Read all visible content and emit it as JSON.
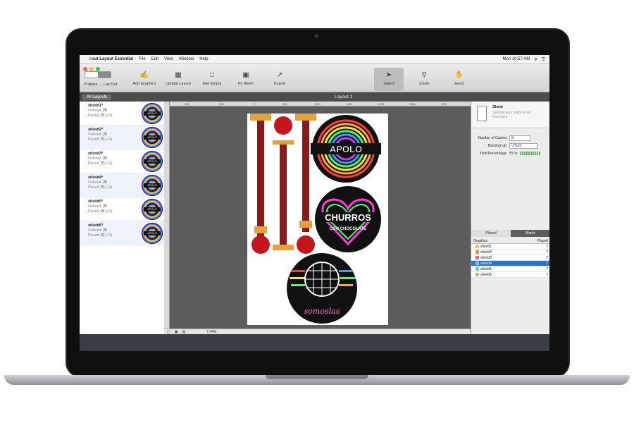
{
  "menubar": {
    "apple": "",
    "app_name": "i-cut Layout Essential",
    "menus": [
      "File",
      "Edit",
      "View",
      "Window",
      "Help"
    ],
    "clock": "Mon 10:57 AM"
  },
  "toolbar": {
    "prepare": "Prepare",
    "arrow": "→",
    "layout": "Lay Out",
    "buttons": [
      "Add Graphics",
      "Update Layout",
      "Add Empty",
      "Fit Sheet",
      "Export"
    ],
    "tools": [
      "Select",
      "Zoom",
      "Hand"
    ]
  },
  "tabbar": {
    "all_layouts": "All Layouts",
    "title": "Layout 1"
  },
  "graphics_list": [
    {
      "name": "shield1*",
      "ordered_label": "Ordered:",
      "ordered": "20",
      "placed_label": "Placed:",
      "placed": "21",
      "extra": "(+1)"
    },
    {
      "name": "shield2*",
      "ordered_label": "Ordered:",
      "ordered": "20",
      "placed_label": "Placed:",
      "placed": "21",
      "extra": "(+1)"
    },
    {
      "name": "shield3*",
      "ordered_label": "Ordered:",
      "ordered": "20",
      "placed_label": "Placed:",
      "placed": "21",
      "extra": "(+1)"
    },
    {
      "name": "shield4*",
      "ordered_label": "Ordered:",
      "ordered": "20",
      "placed_label": "Placed:",
      "placed": "21",
      "extra": "(+1)"
    },
    {
      "name": "shield5*",
      "ordered_label": "Ordered:",
      "ordered": "20",
      "placed_label": "Placed:",
      "placed": "21",
      "extra": "(+1)"
    },
    {
      "name": "shield6*",
      "ordered_label": "Ordered:",
      "ordered": "20",
      "placed_label": "Placed:",
      "placed": "21",
      "extra": "(+1)"
    }
  ],
  "thumb_label": "APOLO",
  "canvas": {
    "ruler_marks": [
      "1000",
      "500",
      "0",
      "500",
      "1000",
      "1500",
      "2000",
      "2500",
      "3000"
    ],
    "artwork": {
      "apolo": "APOLO",
      "churros": "CHURROS",
      "chocolate": "CON CHOCOLATE",
      "somos": "somoslas"
    },
    "zoom": "7.44%"
  },
  "sheet": {
    "title": "Sheet",
    "dims": "2000.00 mm x 3000.00 mm",
    "material": "forex 3mm",
    "copies_label": "Number of Copies:",
    "copies": "3",
    "backing_label": "Backing Up:",
    "backing": "Turn",
    "yield_label": "Yield Percentage:",
    "yield": "55 %"
  },
  "panel_tabs": [
    "Placed",
    "Marks"
  ],
  "graphics_table": {
    "headers": [
      "Graphics",
      "Placed"
    ],
    "rows": [
      {
        "name": "shield1",
        "placed": "7",
        "color": "#f5c542"
      },
      {
        "name": "shield2",
        "placed": "7",
        "color": "#f08a3c"
      },
      {
        "name": "shield3",
        "placed": "7",
        "color": "#e55b9b"
      },
      {
        "name": "shield4",
        "placed": "7",
        "color": "#7bc8f6"
      },
      {
        "name": "shield5",
        "placed": "7",
        "color": "#5fd3a4"
      },
      {
        "name": "shield6",
        "placed": "7",
        "color": "#9ad35f"
      }
    ],
    "selected_index": 3
  }
}
